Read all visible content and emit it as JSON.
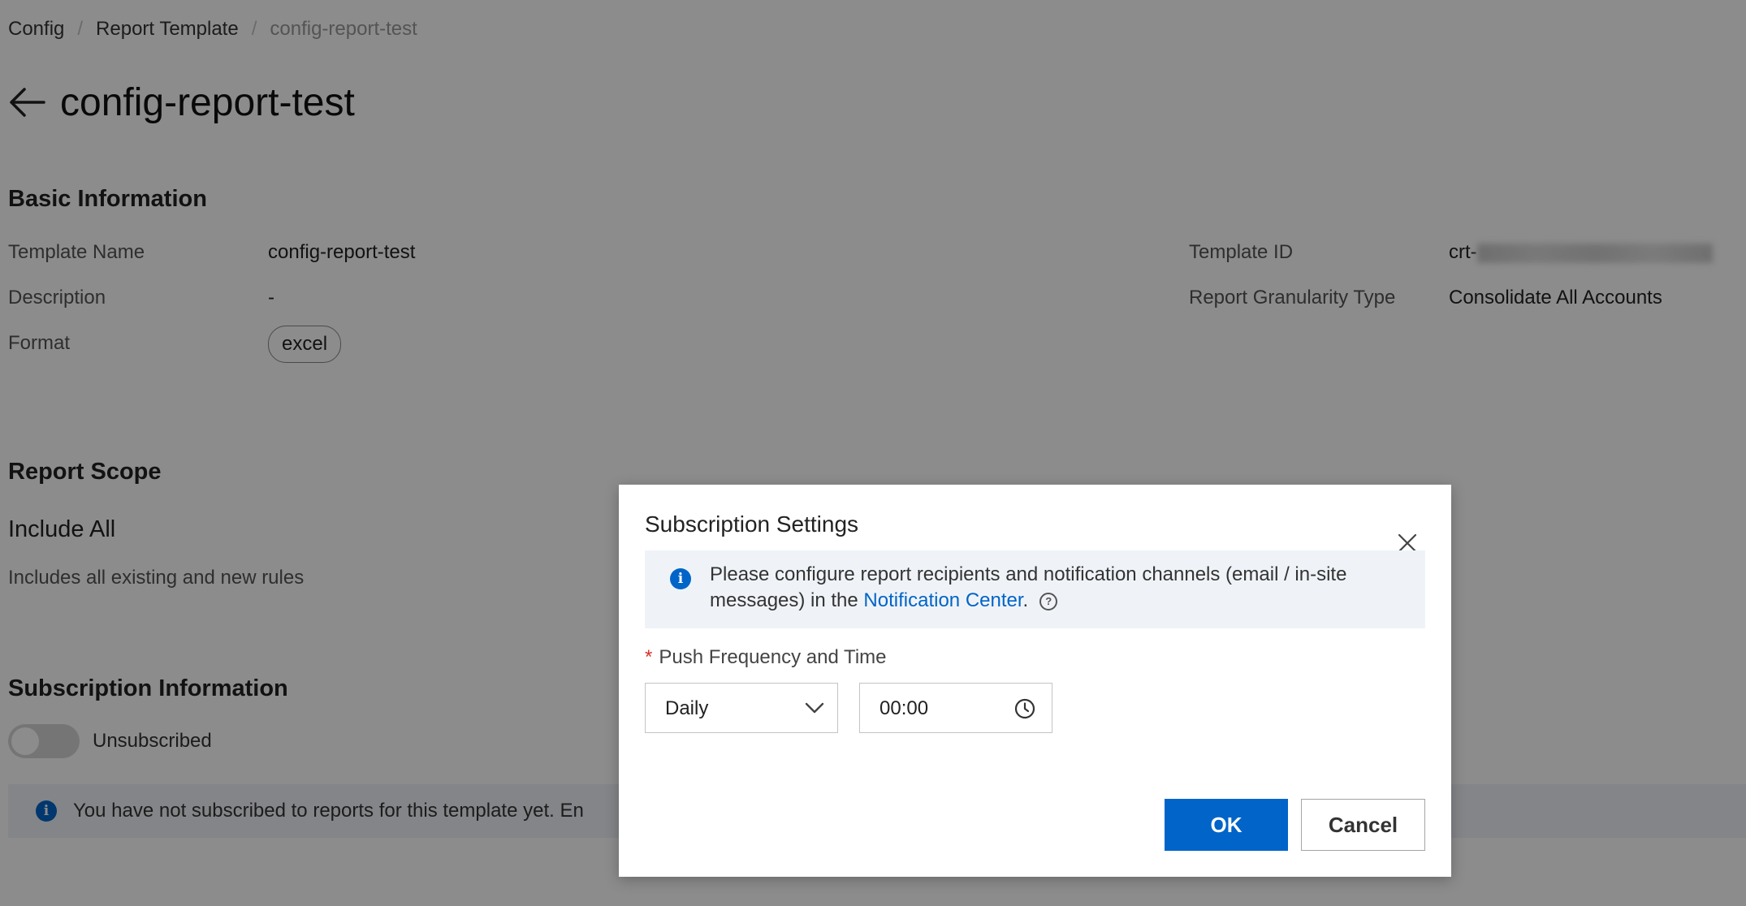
{
  "breadcrumb": {
    "items": [
      "Config",
      "Report Template"
    ],
    "current": "config-report-test"
  },
  "page": {
    "title": "config-report-test",
    "back_icon": "arrow-left-icon"
  },
  "basic_info": {
    "heading": "Basic Information",
    "template_name_label": "Template Name",
    "template_name_value": "config-report-test",
    "description_label": "Description",
    "description_value": "-",
    "format_label": "Format",
    "format_value": "excel",
    "template_id_label": "Template ID",
    "template_id_prefix": "crt-",
    "granularity_label": "Report Granularity Type",
    "granularity_value": "Consolidate All Accounts"
  },
  "report_scope": {
    "heading": "Report Scope",
    "title": "Include All",
    "description": "Includes all existing and new rules"
  },
  "subscription": {
    "heading": "Subscription Information",
    "toggle_label": "Unsubscribed",
    "toggle_on": false,
    "notice": "You have not subscribed to reports for this template yet. En"
  },
  "modal": {
    "title": "Subscription Settings",
    "close_icon": "close-icon",
    "alert_text_before": "Please configure report recipients and notification channels (email / in-site messages) in the ",
    "alert_link": "Notification Center",
    "alert_text_after": ".",
    "help_icon_glyph": "?",
    "field_label": "Push Frequency and Time",
    "required_mark": "*",
    "frequency_value": "Daily",
    "time_value": "00:00",
    "ok_label": "OK",
    "cancel_label": "Cancel"
  },
  "colors": {
    "primary": "#0064c8",
    "required": "#d93026",
    "alert_bg": "#eff3f8"
  }
}
